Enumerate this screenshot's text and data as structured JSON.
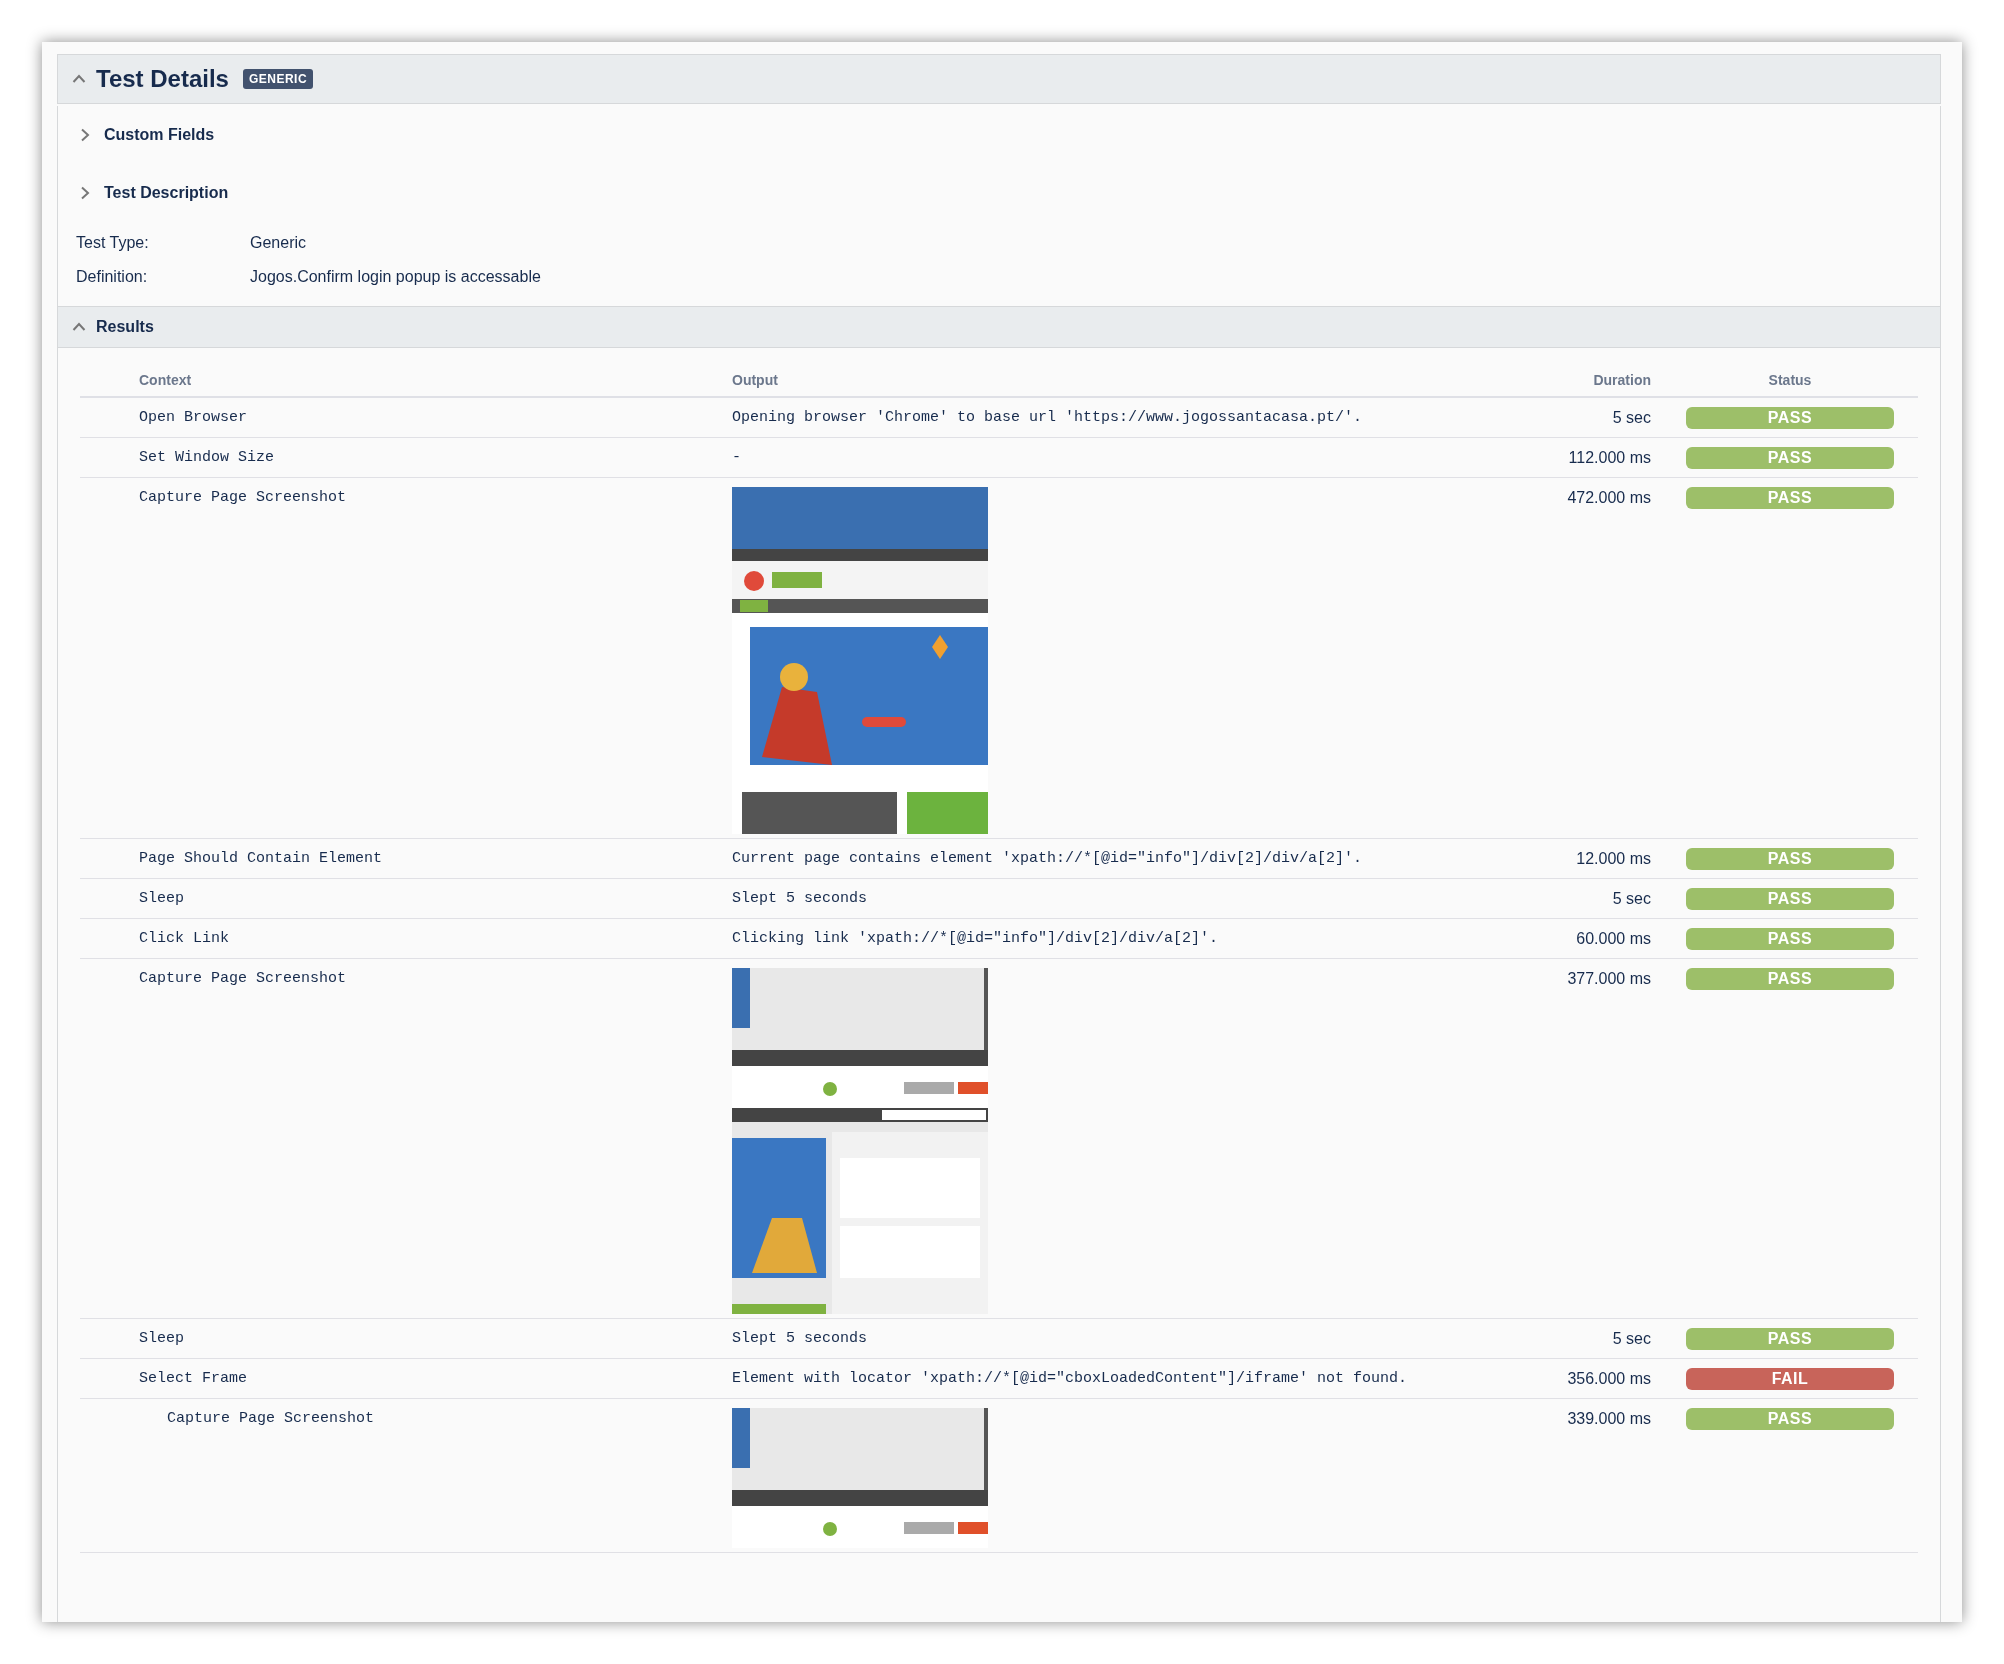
{
  "panel": {
    "title": "Test Details",
    "badge": "GENERIC",
    "expanded": true
  },
  "sections": [
    {
      "label": "Custom Fields",
      "expanded": false
    },
    {
      "label": "Test Description",
      "expanded": false
    }
  ],
  "details": [
    {
      "label": "Test Type:",
      "value": "Generic"
    },
    {
      "label": "Definition:",
      "value": "Jogos.Confirm login popup is accessable"
    }
  ],
  "results": {
    "title": "Results",
    "expanded": true,
    "columns": [
      "Context",
      "Output",
      "Duration",
      "Status"
    ],
    "rows": [
      {
        "kind": "text",
        "context": "Open Browser",
        "output": "Opening browser 'Chrome' to base url 'https://www.jogossantacasa.pt/'.",
        "duration": "5 sec",
        "status": {
          "label": "PASS",
          "color": "#9dbf69"
        }
      },
      {
        "kind": "text",
        "context": "Set Window Size",
        "output": "-",
        "duration": "112.000 ms",
        "status": {
          "label": "PASS",
          "color": "#9dbf69"
        }
      },
      {
        "kind": "screenshot",
        "context": "Capture Page Screenshot",
        "duration": "472.000 ms",
        "status": {
          "label": "PASS",
          "color": "#9dbf69"
        }
      },
      {
        "kind": "text",
        "context": "Page Should Contain Element",
        "output": "Current page contains element 'xpath://*[@id=\"info\"]/div[2]/div/a[2]'.",
        "duration": "12.000 ms",
        "status": {
          "label": "PASS",
          "color": "#9dbf69"
        }
      },
      {
        "kind": "text",
        "context": "Sleep",
        "output": "Slept 5 seconds",
        "duration": "5 sec",
        "status": {
          "label": "PASS",
          "color": "#9dbf69"
        }
      },
      {
        "kind": "text",
        "context": "Click Link",
        "output": "Clicking link 'xpath://*[@id=\"info\"]/div[2]/div/a[2]'.",
        "duration": "60.000 ms",
        "status": {
          "label": "PASS",
          "color": "#9dbf69"
        }
      },
      {
        "kind": "screenshot",
        "context": "Capture Page Screenshot",
        "duration": "377.000 ms",
        "status": {
          "label": "PASS",
          "color": "#9dbf69"
        }
      },
      {
        "kind": "text",
        "context": "Sleep",
        "output": "Slept 5 seconds",
        "duration": "5 sec",
        "status": {
          "label": "PASS",
          "color": "#9dbf69"
        }
      },
      {
        "kind": "text",
        "context": "Select Frame",
        "output": "Element with locator 'xpath://*[@id=\"cboxLoadedContent\"]/iframe' not found.",
        "duration": "356.000 ms",
        "status": {
          "label": "FAIL",
          "color": "#c8645a"
        },
        "children": [
          {
            "kind": "screenshot",
            "context": "Capture Page Screenshot",
            "duration": "339.000 ms",
            "status": {
              "label": "PASS",
              "color": "#9dbf69"
            }
          }
        ]
      }
    ]
  }
}
